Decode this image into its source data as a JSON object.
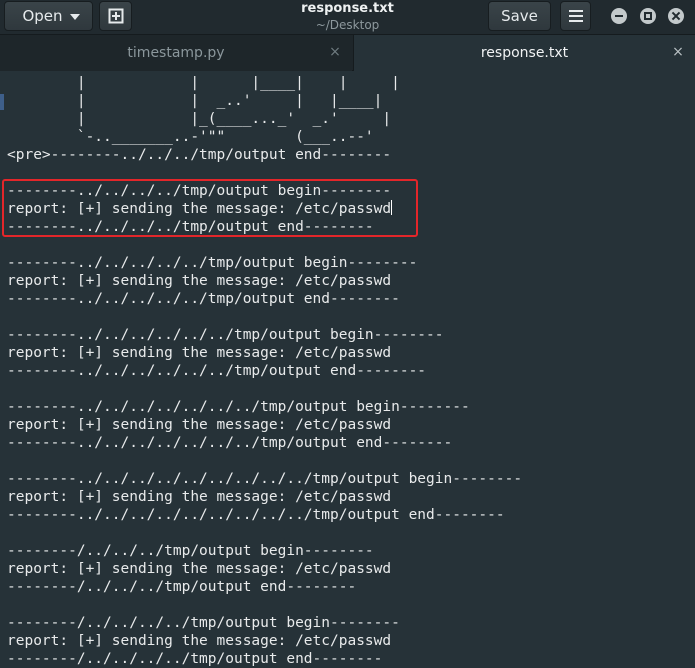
{
  "headerbar": {
    "open_label": "Open",
    "save_label": "Save",
    "title": "response.txt",
    "subtitle": "~/Desktop"
  },
  "tabs": [
    {
      "label": "timestamp.py",
      "close": "×"
    },
    {
      "label": "response.txt",
      "close": "×"
    }
  ],
  "editor": {
    "lines": [
      "        |            |      |____|    |     |",
      "        |            |  _..'     |   |____|",
      "        |            |_(____..._'  _.'     |",
      "        `-.._______..-'\"\"        (___..--'",
      "<pre>--------../../../tmp/output end--------",
      "",
      "--------../../../../tmp/output begin--------",
      "report: [+] sending the message: /etc/passwd",
      "--------../../../../tmp/output end--------",
      "",
      "--------../../../../../tmp/output begin--------",
      "report: [+] sending the message: /etc/passwd",
      "--------../../../../../tmp/output end--------",
      "",
      "--------../../../../../../tmp/output begin--------",
      "report: [+] sending the message: /etc/passwd",
      "--------../../../../../../tmp/output end--------",
      "",
      "--------../../../../../../../tmp/output begin--------",
      "report: [+] sending the message: /etc/passwd",
      "--------../../../../../../../tmp/output end--------",
      "",
      "--------../../../../../../../../../tmp/output begin--------",
      "report: [+] sending the message: /etc/passwd",
      "--------../../../../../../../../../tmp/output end--------",
      "",
      "--------/../../../tmp/output begin--------",
      "report: [+] sending the message: /etc/passwd",
      "--------/../../../tmp/output end--------",
      "",
      "--------/../../../../tmp/output begin--------",
      "report: [+] sending the message: /etc/passwd",
      "--------/../../../../tmp/output end--------"
    ]
  },
  "colors": {
    "background": "#263238",
    "highlight_border": "#e3262a",
    "text": "#e8eaeb"
  },
  "icons": {
    "new_tab": "new-tab-icon",
    "menu": "hamburger-menu-icon",
    "minimize": "minimize-icon",
    "maximize": "maximize-icon",
    "close": "close-icon"
  }
}
